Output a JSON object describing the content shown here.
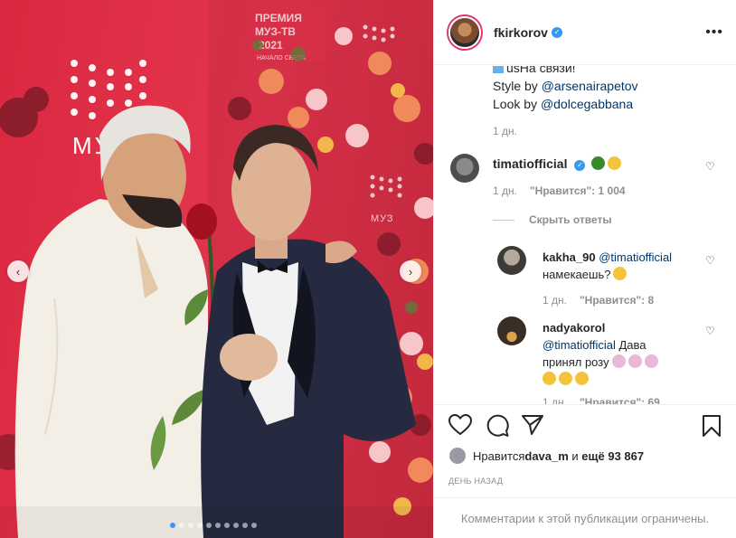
{
  "header": {
    "username": "fkirkorov",
    "more_label": "•••"
  },
  "photo": {
    "sign_line1": "ПРЕМИЯ",
    "sign_line2": "МУЗ-ТВ",
    "sign_line3": "2021",
    "sign_line4": "НАЧАЛО СВЕТА",
    "logo_text": "МУЗ",
    "nav_prev": "‹",
    "nav_next": "›"
  },
  "caption": {
    "line1": "usНа связи!",
    "style_prefix": "Style by ",
    "style_link": "@arsenairapetov",
    "look_prefix": "Look by ",
    "look_link": "@dolcegabbana",
    "time": "1 дн."
  },
  "comments": [
    {
      "username": "timatiofficial",
      "text": "",
      "time": "1 дн.",
      "likes": "\"Нравится\": 1 004",
      "hide_replies": "Скрыть ответы"
    },
    {
      "username": "kakha_90",
      "mention": "@timatiofficial",
      "text": "намекаешь?",
      "time": "1 дн.",
      "likes": "\"Нравится\": 8"
    },
    {
      "username": "nadyakorol",
      "mention": "@timatiofficial",
      "text1": " Дава",
      "text2": "принял розу",
      "time": "1 дн.",
      "likes": "\"Нравится\": 69"
    }
  ],
  "likes": {
    "prefix": "Нравится ",
    "user": "dava_m",
    "middle": " и ",
    "count": "ещё 93 867"
  },
  "date": "ДЕНЬ НАЗАД",
  "footer": "Комментарии к этой публикации ограничены.",
  "colors": {
    "link": "#00376b",
    "verified": "#3897f0",
    "secondary": "#8e8e8e",
    "backdrop": "#e0344c"
  }
}
